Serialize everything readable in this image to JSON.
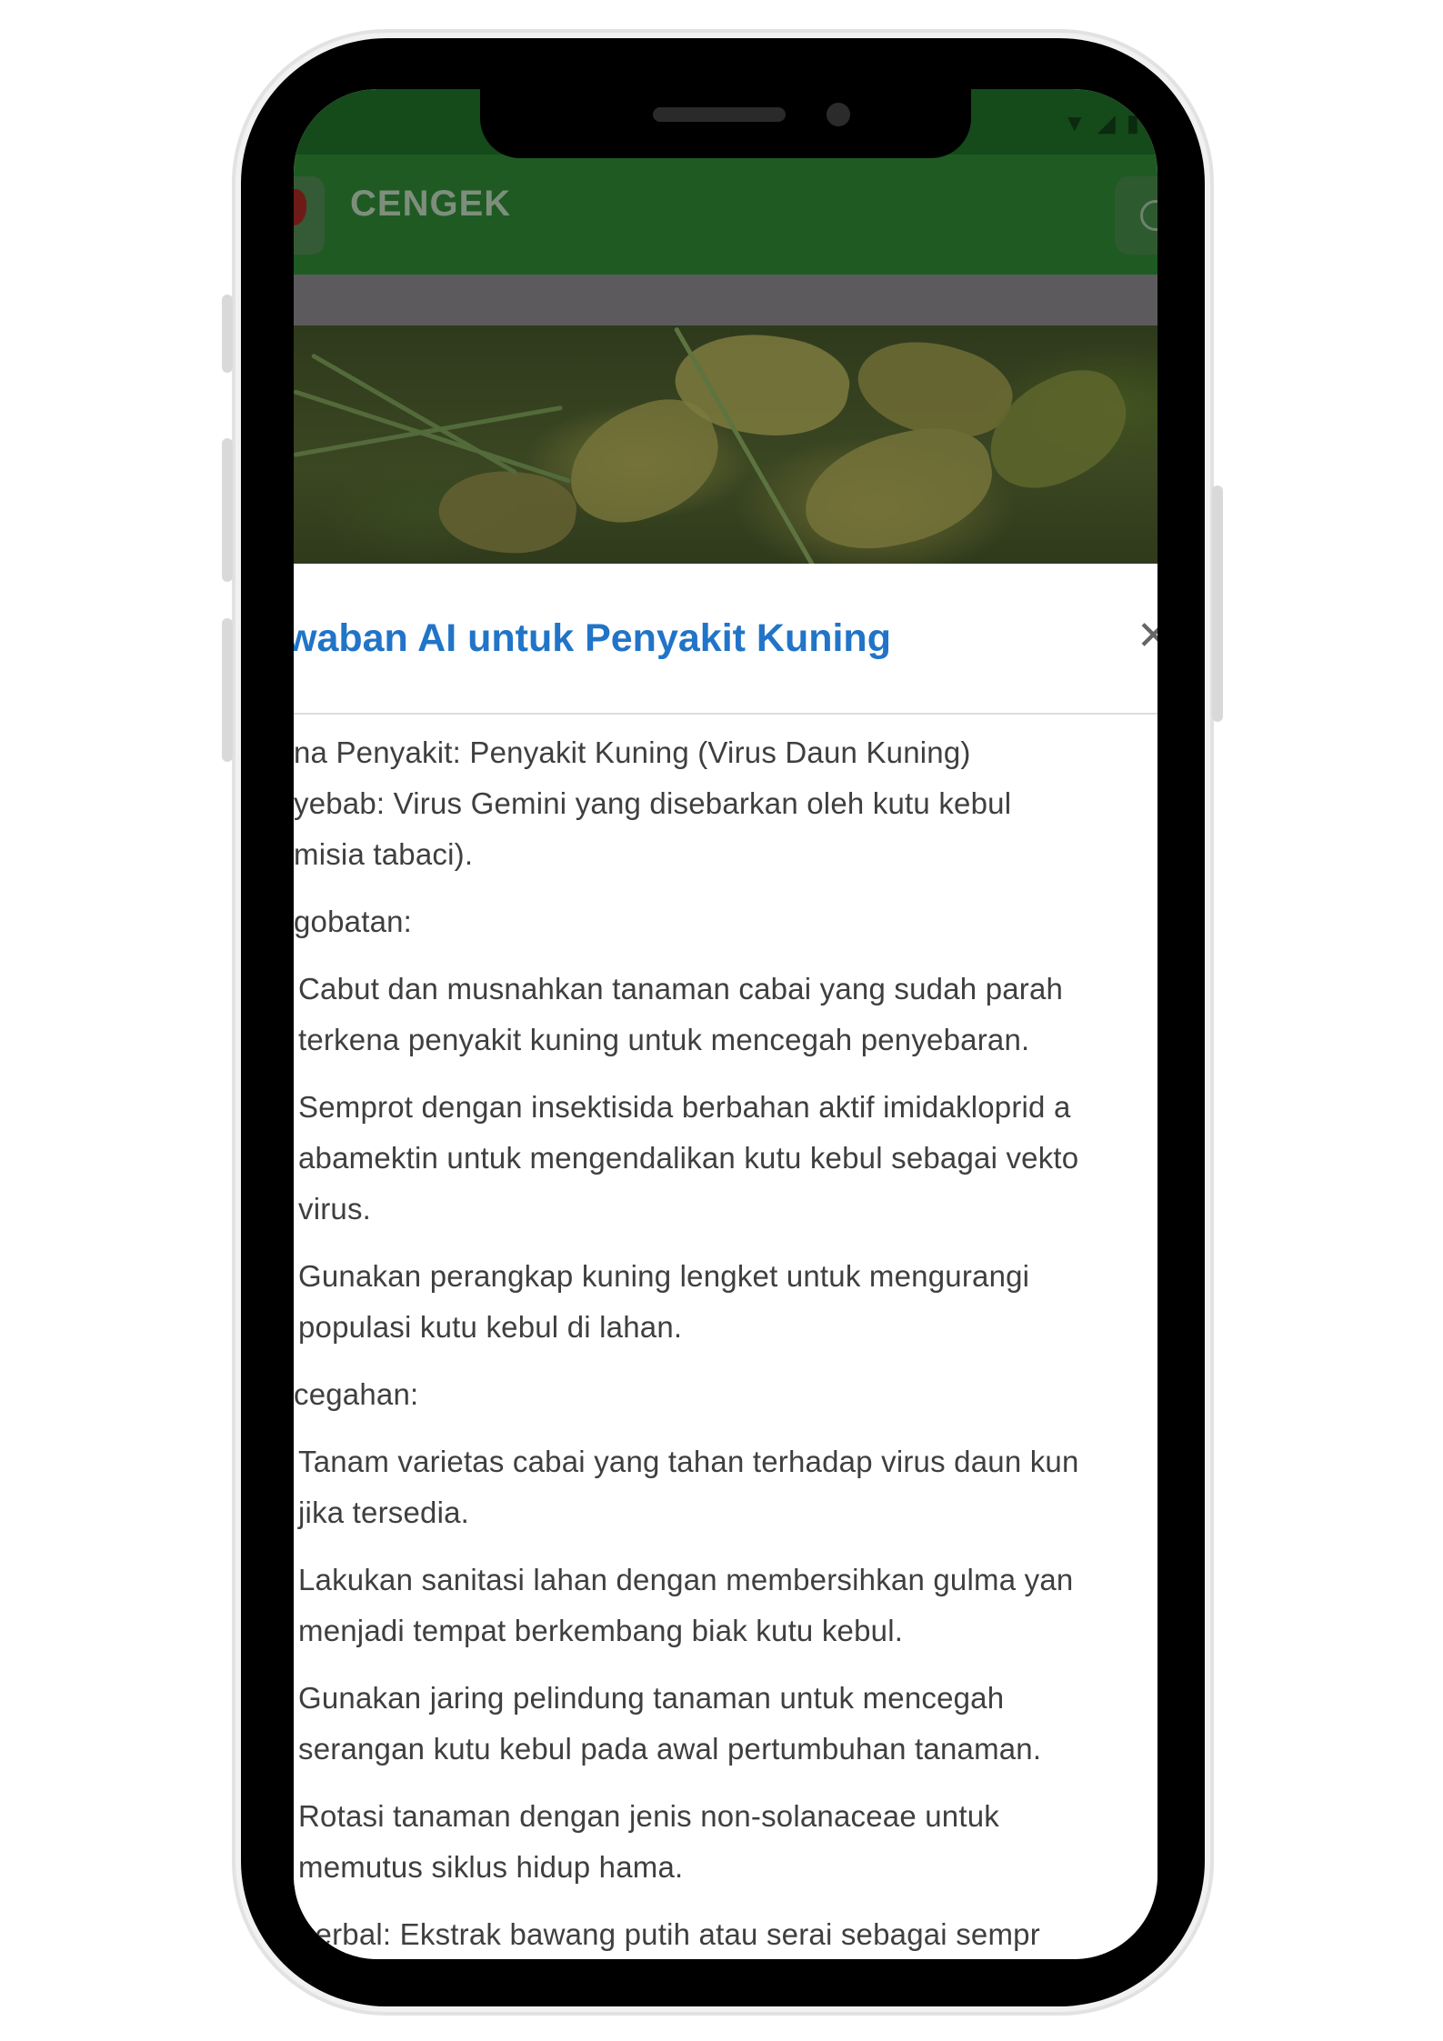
{
  "app": {
    "title": "CENGEK"
  },
  "dialog": {
    "title": "waban AI untuk Penyakit Kuning",
    "close_label": "✕",
    "paragraphs": [
      "na Penyakit: Penyakit Kuning (Virus Daun Kuning)",
      "yebab: Virus Gemini yang disebarkan oleh kutu kebul",
      "misia tabaci).",
      "gobatan:",
      "Cabut dan musnahkan tanaman cabai yang sudah parah",
      "terkena penyakit kuning untuk mencegah penyebaran.",
      "Semprot dengan insektisida berbahan aktif imidakloprid a",
      "abamektin untuk mengendalikan kutu kebul sebagai vekto",
      "virus.",
      "Gunakan perangkap kuning lengket untuk mengurangi",
      "populasi kutu kebul di lahan.",
      "cegahan:",
      "Tanam varietas cabai yang tahan terhadap virus daun kun",
      "jika tersedia.",
      "Lakukan sanitasi lahan dengan membersihkan gulma yan",
      "menjadi tempat berkembang biak kutu kebul.",
      "Gunakan jaring pelindung tanaman untuk mencegah",
      "serangan kutu kebul pada awal pertumbuhan tanaman.",
      "Rotasi tanaman dengan jenis non-solanaceae untuk",
      "memutus siklus hidup hama.",
      "herbal: Ekstrak bawang putih atau serai sebagai sempr"
    ]
  },
  "colors": {
    "app_bar": "#1f5a23",
    "title_blue": "#2174c7",
    "text": "#3f3f3f"
  }
}
